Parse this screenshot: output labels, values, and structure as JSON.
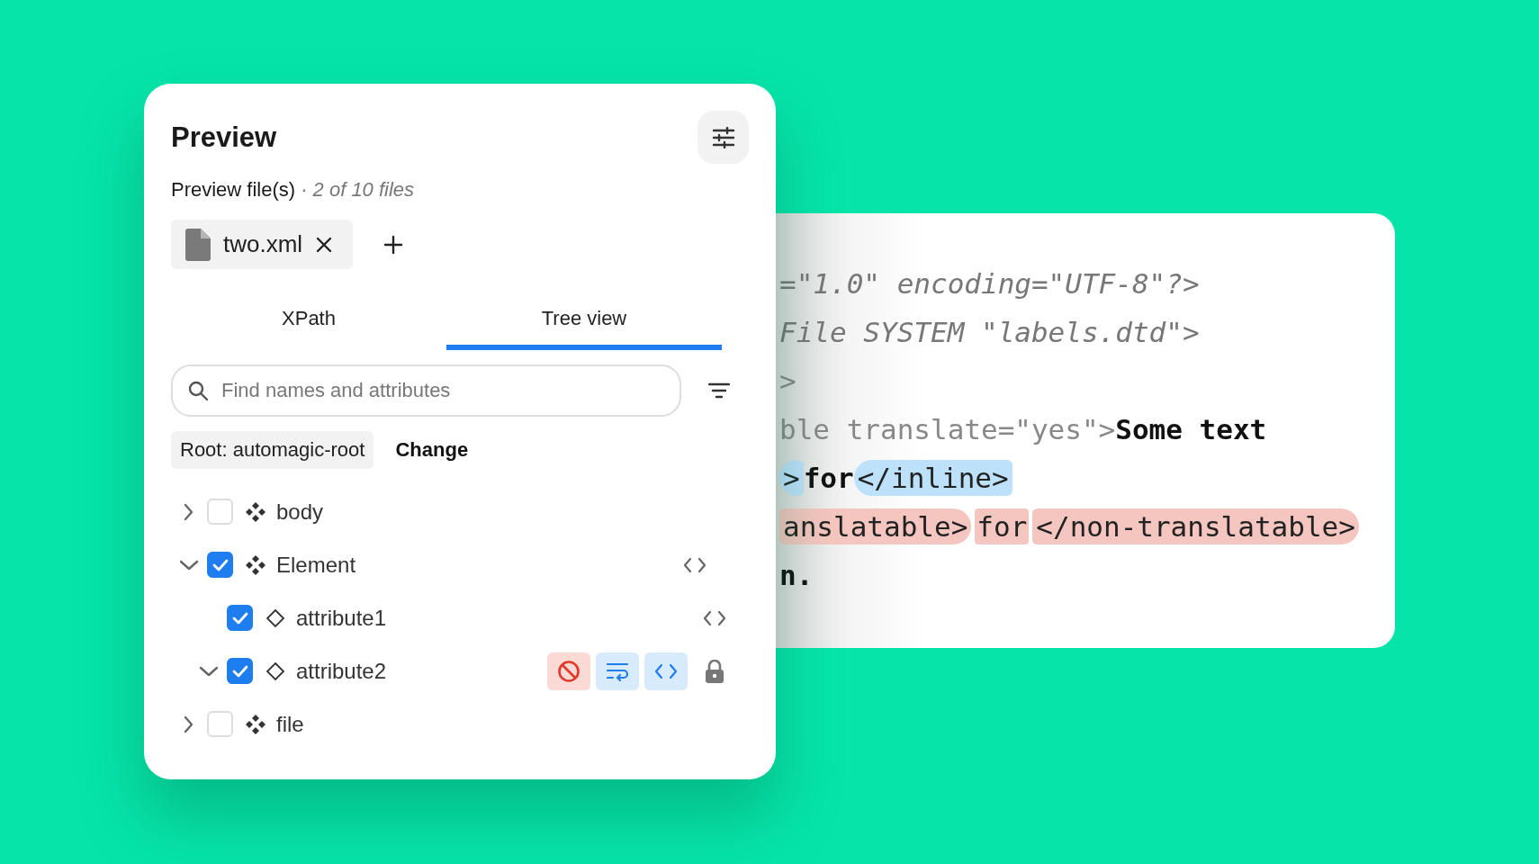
{
  "preview": {
    "title": "Preview",
    "files_label": "Preview file(s)",
    "files_count": "· 2 of 10 files",
    "files": [
      {
        "name": "two.xml"
      }
    ],
    "tabs": [
      {
        "label": "XPath",
        "selected": false
      },
      {
        "label": "Tree view",
        "selected": true
      }
    ],
    "search": {
      "placeholder": "Find names and attributes"
    },
    "root": {
      "label": "Root: automagic-root",
      "action": "Change"
    },
    "tree": [
      {
        "name": "body",
        "kind": "element",
        "expanded": false,
        "checked": false
      },
      {
        "name": "Element",
        "kind": "element",
        "expanded": true,
        "checked": true,
        "actions": [
          {
            "kind": "code",
            "selected": false
          }
        ],
        "children": [
          {
            "name": "attribute1",
            "kind": "attribute",
            "checked": true,
            "actions": [
              {
                "kind": "code",
                "selected": false
              }
            ]
          },
          {
            "name": "attribute2",
            "kind": "attribute",
            "expanded": true,
            "checked": true,
            "actions": [
              {
                "kind": "ignore",
                "selected": true
              },
              {
                "kind": "wrap",
                "selected": true
              },
              {
                "kind": "code",
                "selected": true
              },
              {
                "kind": "lock",
                "selected": false
              }
            ]
          }
        ]
      },
      {
        "name": "file",
        "kind": "element",
        "expanded": false,
        "checked": false
      }
    ]
  },
  "code_lines": [
    {
      "segments": [
        {
          "kind": "meta",
          "text": "=\"1.0\" encoding=\"UTF-8\"?>"
        }
      ]
    },
    {
      "segments": [
        {
          "kind": "meta",
          "text": "File SYSTEM \"labels.dtd\">"
        }
      ]
    },
    {
      "segments": [
        {
          "kind": "markup",
          "text": ">"
        }
      ]
    },
    {
      "segments": [
        {
          "kind": "markup",
          "text": "ble translate=\"yes\">"
        },
        {
          "kind": "text",
          "text": "Some text"
        }
      ]
    },
    {
      "segments": [
        {
          "kind": "inline-tag",
          "text": ">"
        },
        {
          "kind": "text",
          "text": "for"
        },
        {
          "kind": "inline-tag",
          "text": "</inline>"
        }
      ]
    },
    {
      "segments": [
        {
          "kind": "locked-tag",
          "text": "anslatable>"
        },
        {
          "kind": "locked-text",
          "text": "for"
        },
        {
          "kind": "locked-tag",
          "text": "</non-translatable>"
        }
      ]
    },
    {
      "segments": [
        {
          "kind": "text",
          "text": "n."
        }
      ]
    }
  ]
}
